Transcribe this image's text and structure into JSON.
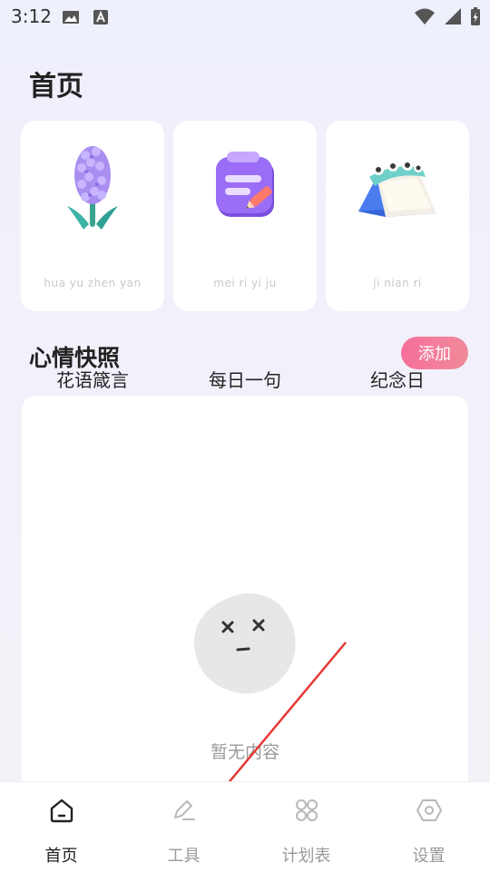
{
  "status_bar": {
    "time": "3:12"
  },
  "page": {
    "title": "首页"
  },
  "cards": [
    {
      "title": "花语箴言",
      "subtitle": "hua yu zhen yan",
      "icon": "hyacinth-icon"
    },
    {
      "title": "每日一句",
      "subtitle": "mei ri yi ju",
      "icon": "notebook-pen-icon"
    },
    {
      "title": "纪念日",
      "subtitle": "ji nian ri",
      "icon": "calendar-icon"
    }
  ],
  "mood_section": {
    "title": "心情快照",
    "add_label": "添加",
    "empty_text": "暂无内容"
  },
  "nav": {
    "items": [
      {
        "label": "首页",
        "icon": "home-icon",
        "active": true
      },
      {
        "label": "工具",
        "icon": "edit-icon",
        "active": false
      },
      {
        "label": "计划表",
        "icon": "grid-icon",
        "active": false
      },
      {
        "label": "设置",
        "icon": "settings-hexagon-icon",
        "active": false
      }
    ]
  },
  "colors": {
    "accent": "#f66f9a",
    "annotation_arrow": "#e53935"
  }
}
